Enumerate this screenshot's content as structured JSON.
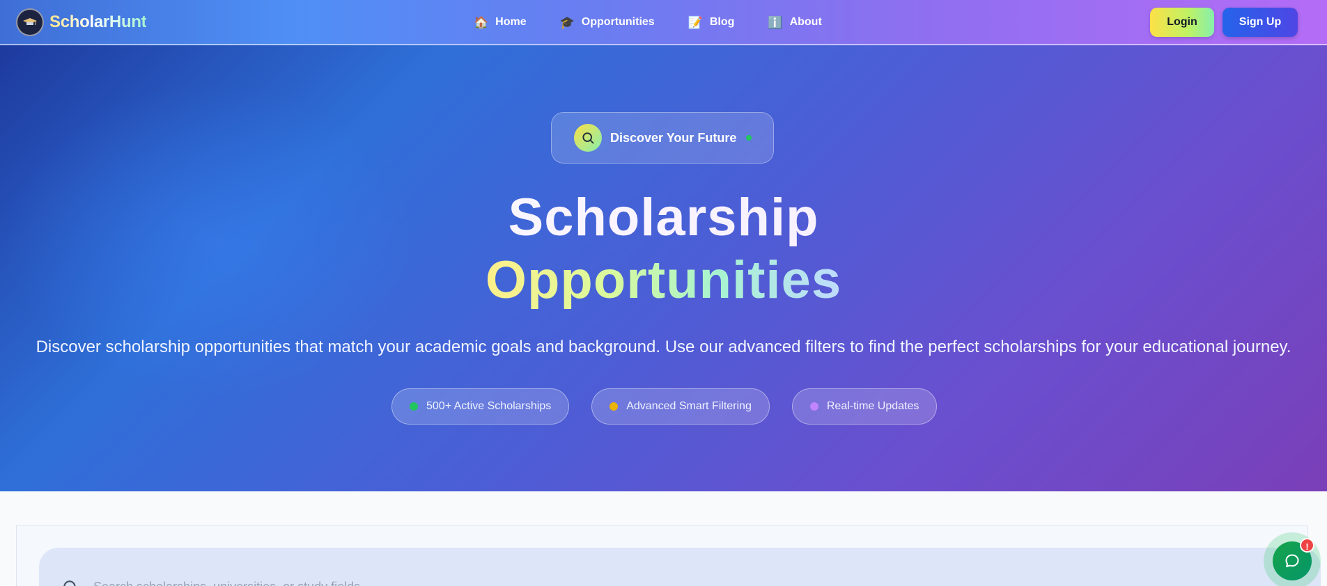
{
  "nav": {
    "brand": "ScholarHunt",
    "links": [
      {
        "icon": "🏠",
        "label": "Home"
      },
      {
        "icon": "🎓",
        "label": "Opportunities"
      },
      {
        "icon": "📝",
        "label": "Blog"
      },
      {
        "icon": "ℹ️",
        "label": "About"
      }
    ],
    "login_label": "Login",
    "signup_label": "Sign Up"
  },
  "hero": {
    "badge_text": "Discover Your Future",
    "title_line1": "Scholarship",
    "title_line2": "Opportunities",
    "subtitle": "Discover scholarship opportunities that match your academic goals and background. Use our advanced filters to find the perfect scholarships for your educational journey.",
    "features": [
      {
        "label": "500+ Active Scholarships",
        "dot_color": "#22c55e"
      },
      {
        "label": "Advanced Smart Filtering",
        "dot_color": "#eab308"
      },
      {
        "label": "Real-time Updates",
        "dot_color": "#c084fc"
      }
    ]
  },
  "search": {
    "placeholder": "Search scholarships, universities, or study fields...",
    "value": ""
  },
  "chat": {
    "badge": "!",
    "icon": "chat-bubble-icon"
  }
}
